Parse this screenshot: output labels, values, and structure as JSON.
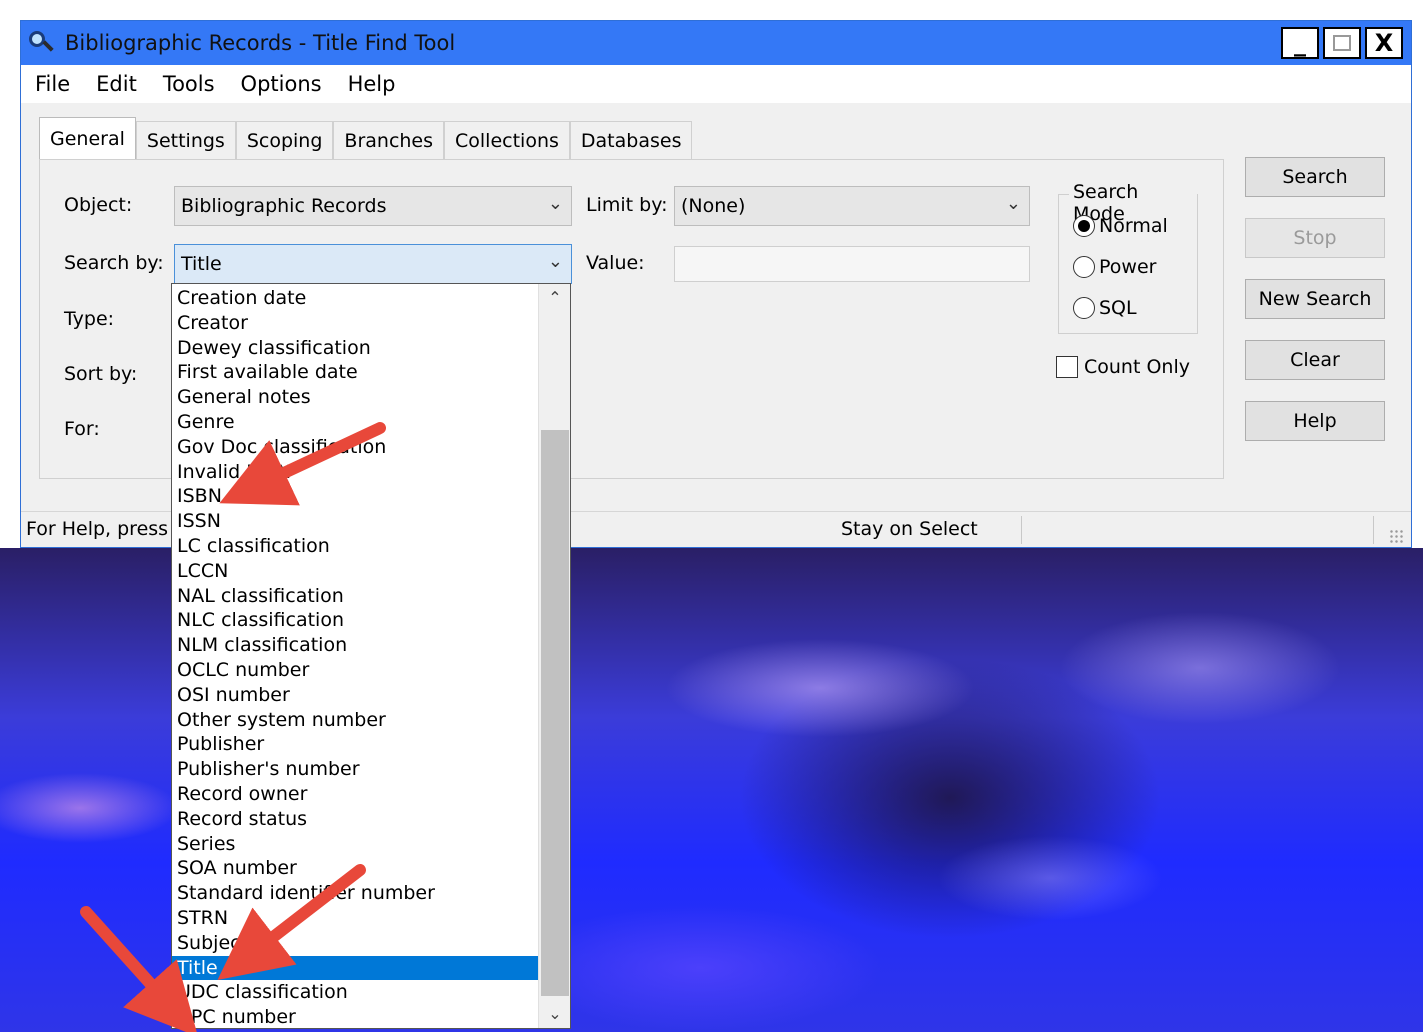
{
  "window": {
    "title": "Bibliographic Records - Title Find Tool",
    "controls": {
      "minimize": "_",
      "close": "X"
    }
  },
  "menu": [
    "File",
    "Edit",
    "Tools",
    "Options",
    "Help"
  ],
  "tabs": [
    "General",
    "Settings",
    "Scoping",
    "Branches",
    "Collections",
    "Databases"
  ],
  "active_tab": "General",
  "form": {
    "object_label": "Object:",
    "object_value": "Bibliographic Records",
    "limit_label": "Limit by:",
    "limit_value": "(None)",
    "searchby_label": "Search by:",
    "searchby_value": "Title",
    "value_label": "Value:",
    "value_value": "",
    "type_label": "Type:",
    "sortby_label": "Sort by:",
    "for_label": "For:"
  },
  "search_mode": {
    "legend": "Search Mode",
    "options": [
      "Normal",
      "Power",
      "SQL"
    ],
    "selected": "Normal"
  },
  "count_only": {
    "label": "Count Only",
    "checked": false
  },
  "buttons": {
    "search": "Search",
    "stop": "Stop",
    "new_search": "New Search",
    "clear": "Clear",
    "help": "Help"
  },
  "status": {
    "help_text": "For Help, press",
    "mode": "Stay on Select"
  },
  "dropdown_items": [
    "Creation date",
    "Creator",
    "Dewey classification",
    "First available date",
    "General notes",
    "Genre",
    "Gov Doc classification",
    "Invalid ISBN",
    "ISBN",
    "ISSN",
    "LC classification",
    "LCCN",
    "NAL classification",
    "NLC classification",
    "NLM classification",
    "OCLC number",
    "OSI number",
    "Other system number",
    "Publisher",
    "Publisher's number",
    "Record owner",
    "Record status",
    "Series",
    "SOA number",
    "Standard identifier number",
    "STRN",
    "Subject",
    "Title",
    "UDC classification",
    "UPC number"
  ],
  "dropdown_selected": "Title",
  "colors": {
    "titlebar": "#3478f6",
    "selection": "#0078d7",
    "arrow": "#e8483a"
  }
}
